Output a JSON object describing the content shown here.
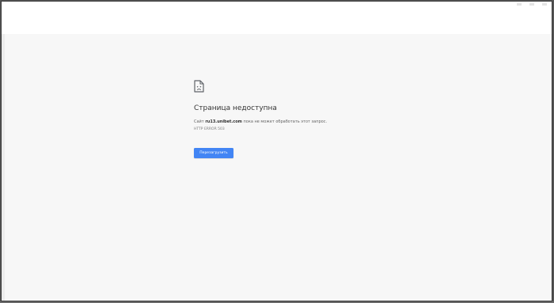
{
  "error_page": {
    "title": "Страница недоступна",
    "description_prefix": "Сайт ",
    "host": "ru13.unibet.com",
    "description_suffix": " пока не может обработать этот запрос.",
    "error_code": "HTTP ERROR 503",
    "reload_label": "Перезагрузить",
    "icon": "sad-document-icon"
  },
  "colors": {
    "background": "#f7f7f7",
    "button": "#4285f4",
    "title_text": "#333333",
    "body_text": "#646464"
  }
}
